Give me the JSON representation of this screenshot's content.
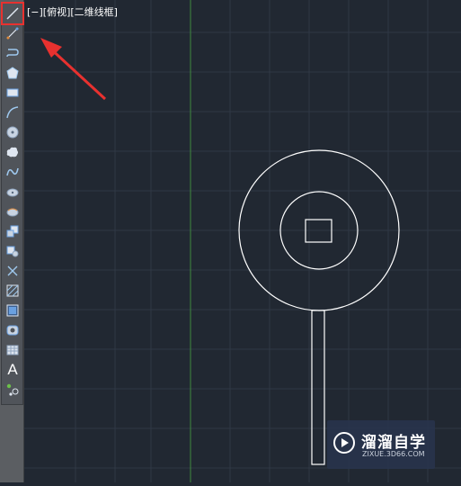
{
  "viewport": {
    "label": "[−][俯视][二维线框]"
  },
  "toolbar": {
    "tools": [
      "line-icon",
      "construction-line-icon",
      "polyline-icon",
      "polygon-icon",
      "rectangle-icon",
      "arc-icon",
      "circle-icon",
      "revision-cloud-icon",
      "spline-icon",
      "ellipse-icon",
      "ellipse-arc-icon",
      "insert-block-icon",
      "make-block-icon",
      "point-icon",
      "hatch-icon",
      "gradient-icon",
      "region-icon",
      "table-icon",
      "multiline-text-icon",
      "add-selected-icon"
    ],
    "active_tool": "line-icon",
    "text_tool_glyph": "A"
  },
  "watermark": {
    "brand": "溜溜自学",
    "url": "ZIXUE.3D66.COM"
  },
  "colors": {
    "canvas_bg": "#212832",
    "grid": "#2f3844",
    "y_axis": "#3f8a3f",
    "drawing_stroke": "#ffffff",
    "highlight": "#e8312f",
    "arrow": "#e8312f"
  }
}
